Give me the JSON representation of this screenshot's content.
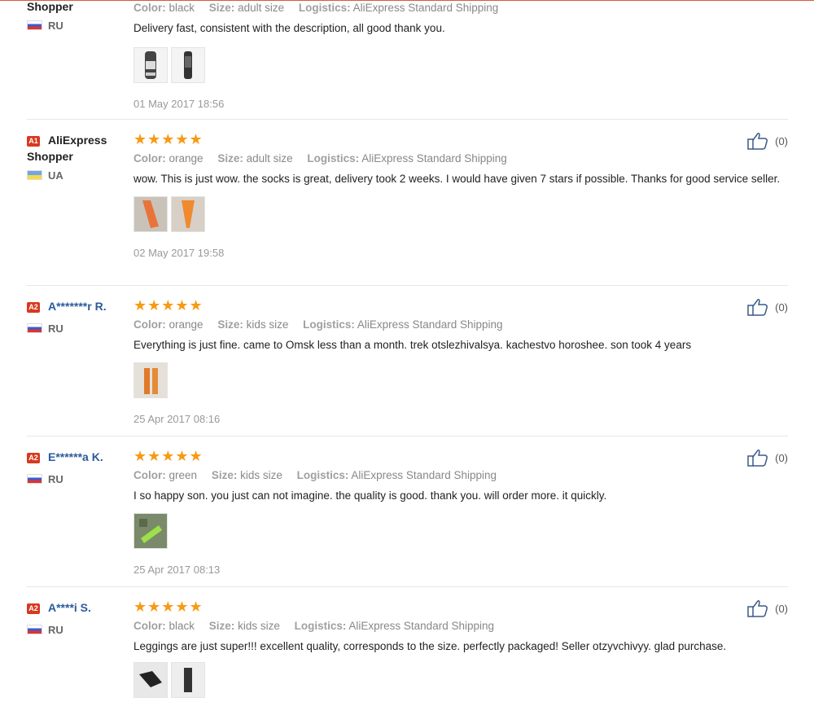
{
  "labels": {
    "color": "Color:",
    "size": "Size:",
    "logistics": "Logistics:"
  },
  "reviews": [
    {
      "badge": "",
      "name": "Shopper",
      "country": "RU",
      "flag": "ru",
      "stars": "★★★★★",
      "color": "black",
      "size": "adult size",
      "logistics": "AliExpress Standard Shipping",
      "text": "Delivery fast, consistent with the description, all good thank you.",
      "date": "01 May 2017 18:56",
      "useful": "",
      "photos": [
        "black-white socks photo",
        "black socks photo"
      ]
    },
    {
      "badge": "A1",
      "name": "AliExpress Shopper",
      "country": "UA",
      "flag": "ua",
      "stars": "★★★★★",
      "color": "orange",
      "size": "adult size",
      "logistics": "AliExpress Standard Shipping",
      "text": "wow. This is just wow. the socks is great, delivery took 2 weeks. I would have given 7 stars if possible. Thanks for good service seller.",
      "date": "02 May 2017 19:58",
      "useful": "(0)",
      "photos": [
        "orange socks photo",
        "orange socks photo"
      ]
    },
    {
      "badge": "A2",
      "name": "A*******r R.",
      "country": "RU",
      "flag": "ru",
      "stars": "★★★★★",
      "color": "orange",
      "size": "kids size",
      "logistics": "AliExpress Standard Shipping",
      "text": "Everything is just fine. came to Omsk less than a month. trek otslezhivalsya. kachestvo horoshee. son took 4 years",
      "date": "25 Apr 2017 08:16",
      "useful": "(0)",
      "photos": [
        "orange socks photo"
      ]
    },
    {
      "badge": "A2",
      "name": "E******a K.",
      "country": "RU",
      "flag": "ru",
      "stars": "★★★★★",
      "color": "green",
      "size": "kids size",
      "logistics": "AliExpress Standard Shipping",
      "text": "I so happy son. you just can not imagine. the quality is good. thank you. will order more. it quickly.",
      "date": "25 Apr 2017 08:13",
      "useful": "(0)",
      "photos": [
        "green socks photo"
      ]
    },
    {
      "badge": "A2",
      "name": "A****i S.",
      "country": "RU",
      "flag": "ru",
      "stars": "★★★★★",
      "color": "black",
      "size": "kids size",
      "logistics": "AliExpress Standard Shipping",
      "text": "Leggings are just super!!! excellent quality, corresponds to the size. perfectly packaged! Seller otzyvchivyy. glad purchase.",
      "date": "",
      "useful": "(0)",
      "photos": [
        "black leggings photo",
        "black leggings photo"
      ]
    }
  ],
  "colors": {
    "star": "#f79a13",
    "badge": "#d8391f",
    "name_link": "#2a5b9c",
    "accent_line": "#d95a3a"
  }
}
